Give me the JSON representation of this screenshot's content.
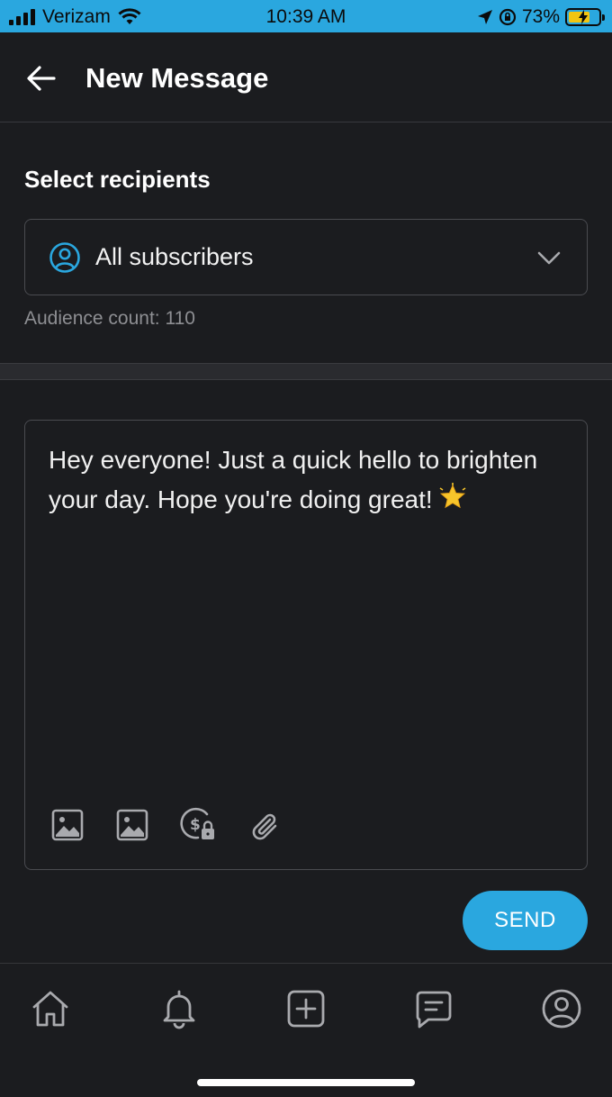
{
  "status_bar": {
    "carrier": "Verizam",
    "time": "10:39 AM",
    "battery_percent": "73%",
    "battery_level": 0.73,
    "colors": {
      "background": "#2aa7df",
      "battery_fill": "#f2c511"
    }
  },
  "header": {
    "title": "New Message",
    "back_icon": "arrow-left-icon"
  },
  "recipients": {
    "title": "Select recipients",
    "selected_value": "All subscribers",
    "select_icon": "user-circle-icon",
    "dropdown_icon": "chevron-down-icon",
    "audience_count_label": "Audience count: 110"
  },
  "message": {
    "text": "Hey everyone! Just a quick hello to brighten your day. Hope you're doing great!",
    "emoji": "star-emoji",
    "toolbar": [
      "image-icon",
      "image-icon",
      "locked-price-icon",
      "paperclip-icon"
    ]
  },
  "send_button": {
    "label": "SEND",
    "color": "#2aa7df"
  },
  "bottom_nav": {
    "items": [
      "home-icon",
      "bell-icon",
      "plus-square-icon",
      "message-icon",
      "profile-icon"
    ]
  }
}
